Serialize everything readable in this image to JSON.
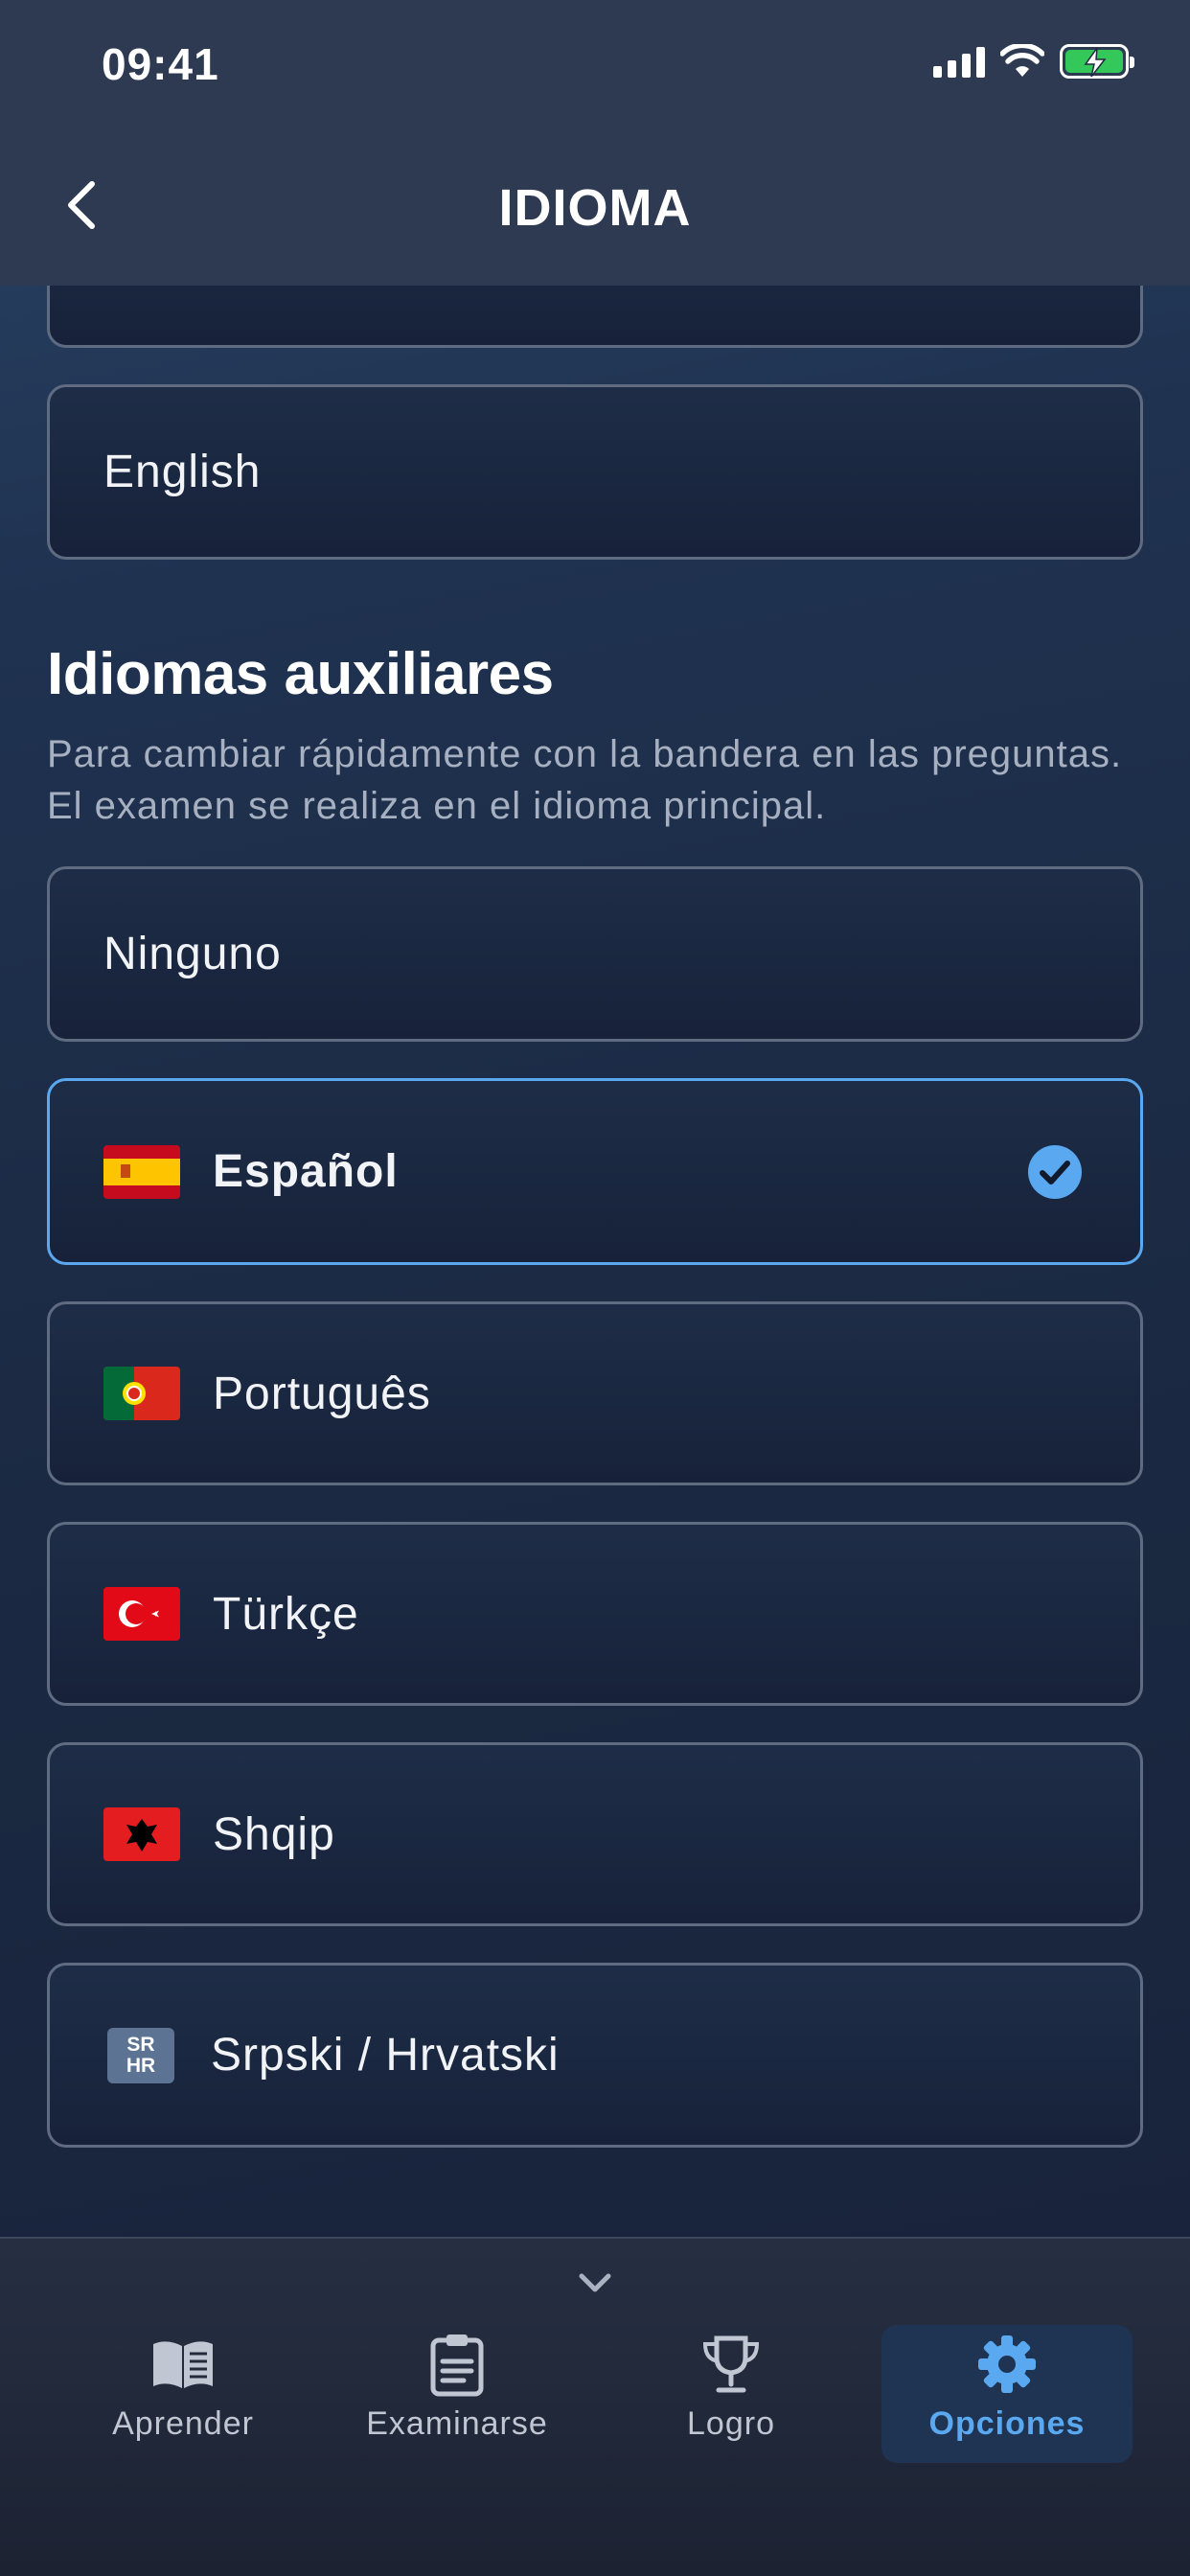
{
  "status_bar": {
    "time": "09:41"
  },
  "nav": {
    "title": "IDIOMA"
  },
  "main_language": {
    "selected": "English"
  },
  "auxiliary": {
    "title": "Idiomas auxiliares",
    "description": "Para cambiar rápidamente con la bandera en las preguntas. El examen se realiza en el idioma principal.",
    "options": [
      {
        "label": "Ninguno",
        "flag": "none",
        "selected": false
      },
      {
        "label": "Español",
        "flag": "spain-flag",
        "selected": true
      },
      {
        "label": "Português",
        "flag": "portugal-flag",
        "selected": false
      },
      {
        "label": "Türkçe",
        "flag": "turkey-flag",
        "selected": false
      },
      {
        "label": "Shqip",
        "flag": "albania-flag",
        "selected": false
      },
      {
        "label": "Srpski / Hrvatski",
        "flag": "sr-hr-badge",
        "badge_lines": [
          "SR",
          "HR"
        ],
        "selected": false
      }
    ]
  },
  "tabbar": {
    "tabs": [
      {
        "label": "Aprender",
        "icon": "book-icon",
        "active": false
      },
      {
        "label": "Examinarse",
        "icon": "clipboard-icon",
        "active": false
      },
      {
        "label": "Logro",
        "icon": "trophy-icon",
        "active": false
      },
      {
        "label": "Opciones",
        "icon": "gear-icon",
        "active": true
      }
    ]
  },
  "colors": {
    "accent": "#5aa9f0",
    "background": "#1b2942",
    "card_border": "#5f6b80",
    "header": "#2e3a52"
  }
}
